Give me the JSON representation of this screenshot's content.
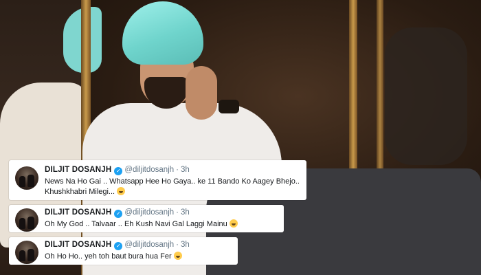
{
  "tweets": [
    {
      "name": "DILJIT DOSANJH",
      "handle": "@diljitdosanjh",
      "time": "3h",
      "text_line1": "News Na Ho Gai .. Whatsapp Hee Ho Gaya.. ke 11 Bando Ko Aagey Bhejo..",
      "text_line2": "Khushkhabri Milegi..."
    },
    {
      "name": "DILJIT DOSANJH",
      "handle": "@diljitdosanjh",
      "time": "3h",
      "text_line1": "Oh My God .. Talvaar .. Eh Kush Navi Gal Laggi Mainu"
    },
    {
      "name": "DILJIT DOSANJH",
      "handle": "@diljitdosanjh",
      "time": "3h",
      "text_line1": "Oh Ho Ho.. yeh toh baut bura hua Fer"
    }
  ],
  "icons": {
    "verified": "verified-badge-icon",
    "emoji": "rolling-laughing-emoji-icon"
  },
  "colors": {
    "verified_blue": "#1da1f2",
    "text_dark": "#14171a",
    "text_muted": "#657786",
    "turban": "#6fd4cc"
  }
}
